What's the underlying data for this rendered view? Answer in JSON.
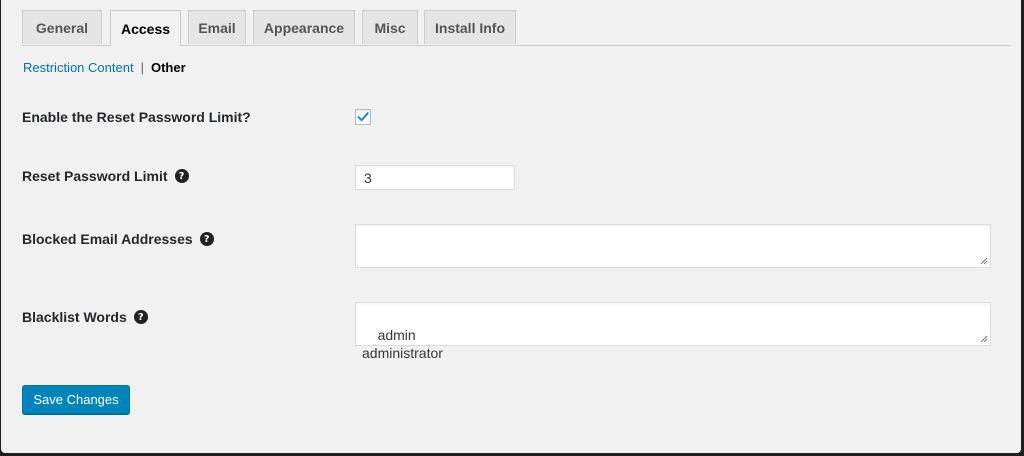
{
  "tabs": [
    {
      "label": "General",
      "active": false
    },
    {
      "label": "Access",
      "active": true
    },
    {
      "label": "Email",
      "active": false
    },
    {
      "label": "Appearance",
      "active": false
    },
    {
      "label": "Misc",
      "active": false
    },
    {
      "label": "Install Info",
      "active": false
    }
  ],
  "subnav": {
    "link": "Restriction Content",
    "separator": "|",
    "current": "Other"
  },
  "form": {
    "reset_enable_label": "Enable the Reset Password Limit?",
    "reset_enable_checked": true,
    "reset_limit_label": "Reset Password Limit",
    "reset_limit_value": "3",
    "blocked_emails_label": "Blocked Email Addresses",
    "blocked_emails_value": "",
    "blacklist_label": "Blacklist Words",
    "blacklist_value": "admin\nadministrator",
    "help_glyph": "?"
  },
  "save_label": "Save Changes",
  "icons": {
    "check": "checkmark-icon",
    "help": "help-icon"
  },
  "colors": {
    "link": "#0073aa",
    "primary_button": "#0085ba",
    "check": "#1e8cbe"
  }
}
